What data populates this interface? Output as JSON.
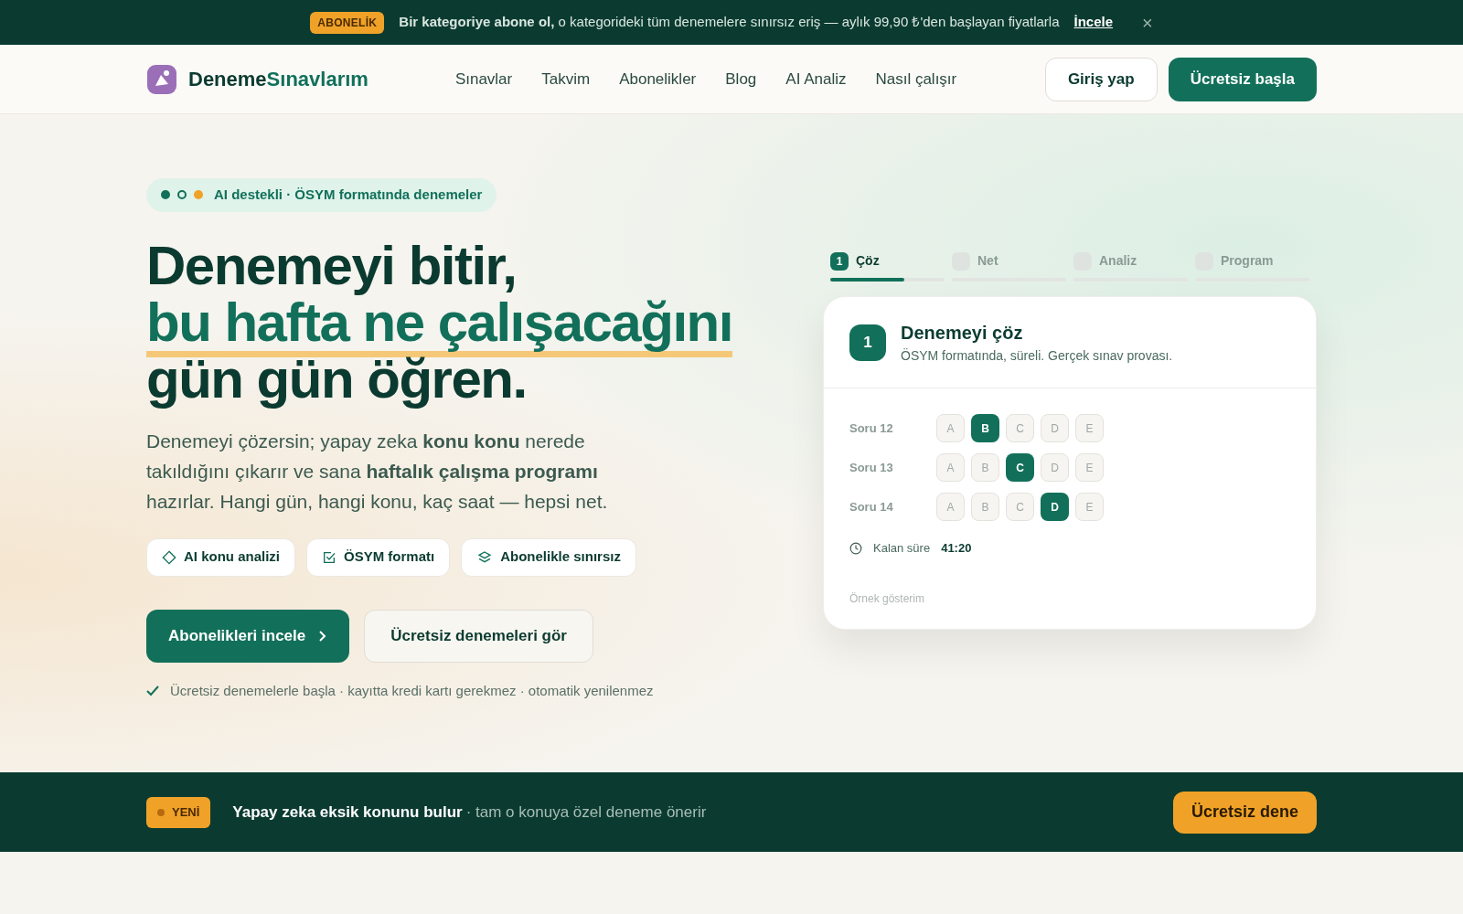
{
  "announcement": {
    "badge": "ABONELİK",
    "text": "**Bir kategoriye abone ol,** o kategorideki tüm denemelere sınırsız eriş — aylık 99,90 ₺'den başlayan fiyatlarla",
    "link": "İncele",
    "close": "×"
  },
  "nav": {
    "logo_dark": "Deneme",
    "logo_green": "Sınavlarım",
    "links": [
      "Sınavlar",
      "Takvim",
      "Abonelikler",
      "Blog",
      "AI Analiz",
      "Nasıl çalışır"
    ],
    "login": "Giriş yap",
    "cta": "Ücretsiz başla"
  },
  "hero": {
    "pill": "AI destekli · ÖSYM formatında denemeler",
    "headline": [
      {
        "kind": "plain",
        "text": "Denemeyi bitir,"
      },
      {
        "kind": "highlight",
        "text": "bu hafta ne çalışacağını"
      },
      {
        "kind": "plain",
        "text": "gün gün öğren."
      }
    ],
    "description": "Denemeyi çözersin; yapay zeka **konu konu** nerede takıldığını çıkarır ve sana **haftalık çalışma programı** hazırlar. Hangi gün, hangi konu, kaç saat — hepsi net.",
    "features": [
      {
        "kind": "diamond",
        "label": "AI konu analizi"
      },
      {
        "kind": "check",
        "label": "ÖSYM formatı"
      },
      {
        "kind": "layers",
        "label": "Abonelikle sınırsız"
      }
    ],
    "primary": "Abonelikleri incele",
    "secondary": "Ücretsiz denemeleri gör",
    "note": "Ücretsiz denemelerle başla · kayıtta kredi kartı gerekmez · otomatik yenilenmez"
  },
  "demo": {
    "steps": [
      {
        "number": "1",
        "label": "Çöz",
        "selected": true,
        "level": 0.65
      },
      {
        "label": "Net",
        "selected": false
      },
      {
        "label": "Analiz",
        "selected": false
      },
      {
        "label": "Program",
        "selected": false
      }
    ],
    "card": {
      "number": "1",
      "title": "Denemeyi çöz",
      "subtitle": "ÖSYM formatında, süreli. Gerçek sınav provası.",
      "questions": [
        {
          "label": "Soru 12",
          "options": [
            {
              "label": "A",
              "selected": false
            },
            {
              "label": "B",
              "selected": true
            },
            {
              "label": "C",
              "selected": false
            },
            {
              "label": "D",
              "selected": false
            },
            {
              "label": "E",
              "selected": false
            }
          ]
        },
        {
          "label": "Soru 13",
          "options": [
            {
              "label": "A",
              "selected": false
            },
            {
              "label": "B",
              "selected": false
            },
            {
              "label": "C",
              "selected": true
            },
            {
              "label": "D",
              "selected": false
            },
            {
              "label": "E",
              "selected": false
            }
          ]
        },
        {
          "label": "Soru 14",
          "options": [
            {
              "label": "A",
              "selected": false
            },
            {
              "label": "B",
              "selected": false
            },
            {
              "label": "C",
              "selected": false
            },
            {
              "label": "D",
              "selected": true
            },
            {
              "label": "E",
              "selected": false
            }
          ]
        }
      ],
      "timer_label": "Kalan süre",
      "timer_value": "41:20",
      "footnote": "Örnek gösterim"
    }
  },
  "promo": {
    "badge": "YENİ",
    "title": "Yapay zeka eksik konunu bulur",
    "text": "· tam o konuya özel deneme önerir",
    "cta": "Ücretsiz dene"
  }
}
